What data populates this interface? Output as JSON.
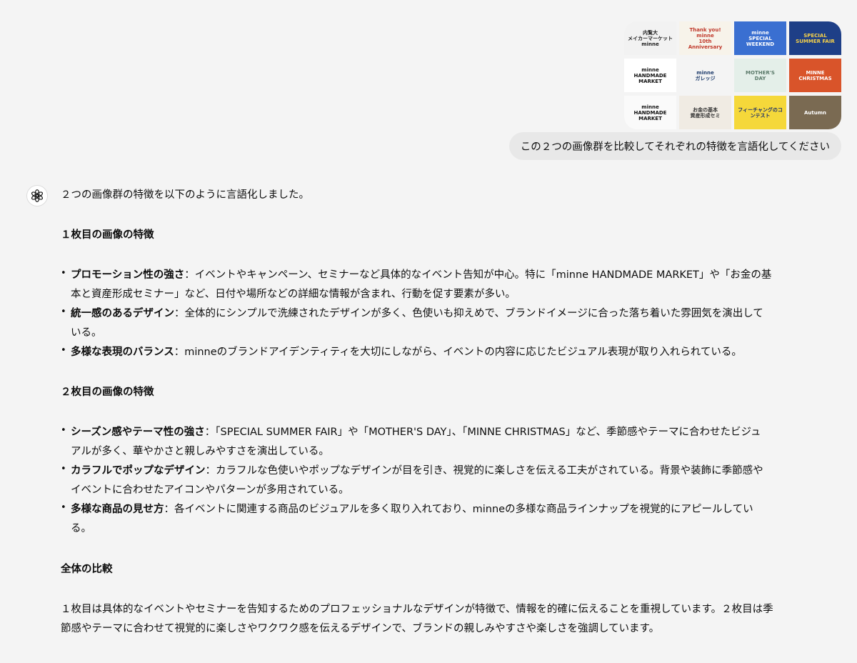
{
  "user": {
    "images": [
      {
        "label": "内覧大\nメイカーマーケット\nminne",
        "bg": "#f2f2f2",
        "fg": "#222"
      },
      {
        "label": "Thank you!\nminne\n10th Anniversary",
        "bg": "#f7f3ea",
        "fg": "#c0392b"
      },
      {
        "label": "minne\nSPECIAL\nWEEKEND",
        "bg": "#3a6fd1",
        "fg": "#ffffff"
      },
      {
        "label": "SPECIAL\nSUMMER FAIR",
        "bg": "#1e3f87",
        "fg": "#f5d04a"
      },
      {
        "label": "minne\nHANDMADE\nMARKET",
        "bg": "#ffffff",
        "fg": "#111"
      },
      {
        "label": "minne\nガレッジ",
        "bg": "#f4f4f4",
        "fg": "#1d3b6b"
      },
      {
        "label": "MOTHER'S\nDAY",
        "bg": "#e4efe9",
        "fg": "#5b7a6a"
      },
      {
        "label": "MINNE CHRISTMAS",
        "bg": "#d9542a",
        "fg": "#ffffff"
      },
      {
        "label": "minne\nHANDMADE\nMARKET",
        "bg": "#fafafa",
        "fg": "#111"
      },
      {
        "label": "お金の基本\n資産形成セミ",
        "bg": "#f0ebe3",
        "fg": "#333"
      },
      {
        "label": "フィーチャングのコンテスト",
        "bg": "#f5d83a",
        "fg": "#1c2f6b"
      },
      {
        "label": "Autumn",
        "bg": "#7a6a52",
        "fg": "#ffffff"
      }
    ],
    "message": "この２つの画像群を比較してそれぞれの特徴を言語化してください"
  },
  "assistant": {
    "intro": "２つの画像群の特徴を以下のように言語化しました。",
    "section1": {
      "heading": "１枚目の画像の特徴",
      "items": [
        {
          "title": "プロモーション性の強さ",
          "lines": [
            "：イベントやキャンペーン、セミナーなど具体的なイベント告知が中心。特に「minne HANDMADE MARKET」や「お金の基",
            "本と資産形成セミナー」など、日付や場所などの詳細な情報が含まれ、行動を促す要素が多い。"
          ]
        },
        {
          "title": "統一感のあるデザイン",
          "lines": [
            "：全体的にシンプルで洗練されたデザインが多く、色使いも抑えめで、ブランドイメージに合った落ち着いた雰囲気を演出して",
            "いる。"
          ]
        },
        {
          "title": "多様な表現のバランス",
          "lines": [
            "：minneのブランドアイデンティティを大切にしながら、イベントの内容に応じたビジュアル表現が取り入れられている。"
          ]
        }
      ]
    },
    "section2": {
      "heading": "２枚目の画像の特徴",
      "items": [
        {
          "title": "シーズン感やテーマ性の強さ",
          "lines": [
            "：「SPECIAL SUMMER FAIR」や「MOTHER'S DAY」、「MINNE CHRISTMAS」など、季節感やテーマに合わせたビジュ",
            "アルが多く、華やかさと親しみやすさを演出している。"
          ]
        },
        {
          "title": "カラフルでポップなデザイン",
          "lines": [
            "：カラフルな色使いやポップなデザインが目を引き、視覚的に楽しさを伝える工夫がされている。背景や装飾に季節感や",
            "イベントに合わせたアイコンやパターンが多用されている。"
          ]
        },
        {
          "title": "多様な商品の見せ方",
          "lines": [
            "：各イベントに関連する商品のビジュアルを多く取り入れており、minneの多様な商品ラインナップを視覚的にアピールしてい",
            "る。"
          ]
        }
      ]
    },
    "section3": {
      "heading": "全体の比較",
      "lines": [
        "１枚目は具体的なイベントやセミナーを告知するためのプロフェッショナルなデザインが特徴で、情報を的確に伝えることを重視しています。２枚目は季",
        "節感やテーマに合わせて視覚的に楽しさやワクワク感を伝えるデザインで、ブランドの親しみやすさや楽しさを強調しています。"
      ]
    }
  }
}
